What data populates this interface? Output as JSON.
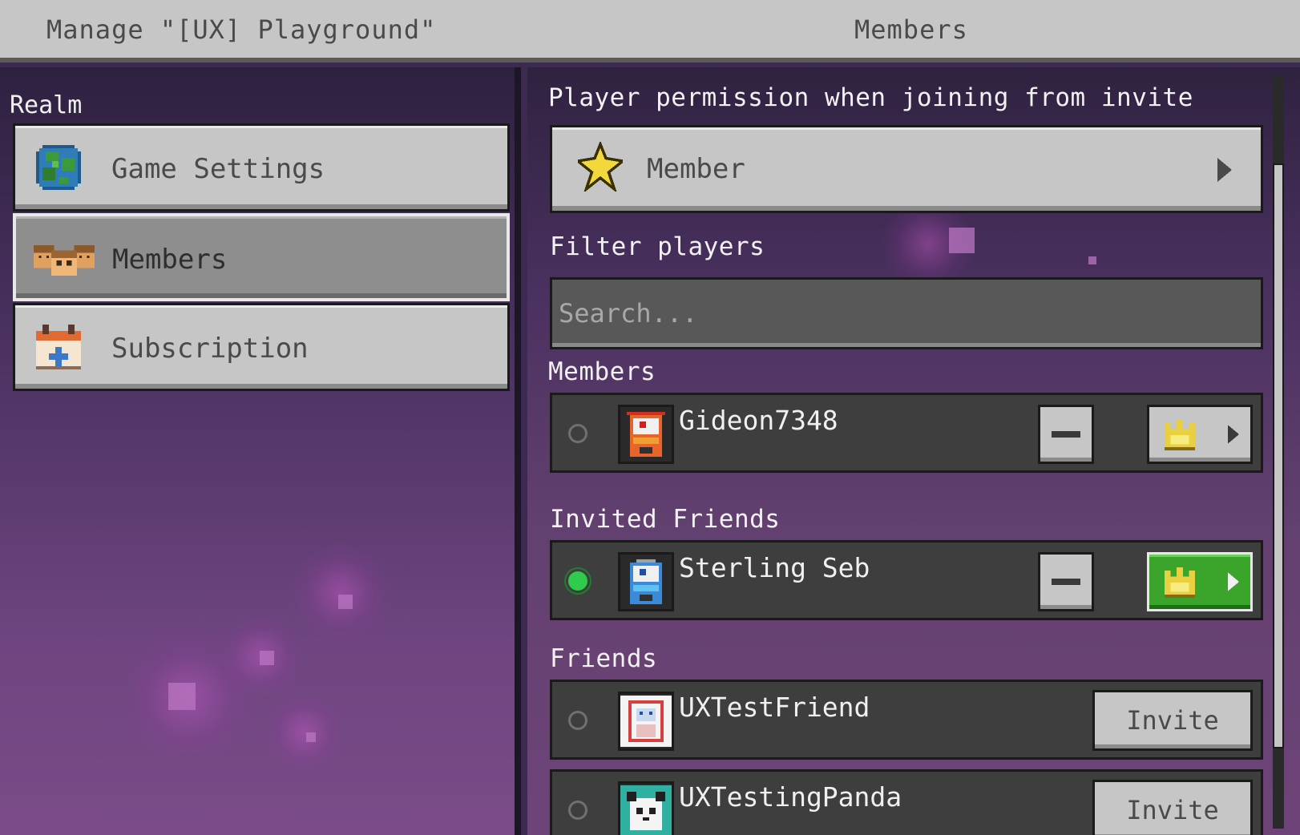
{
  "header": {
    "title": "Manage \"[UX] Playground\"",
    "section_title": "Members"
  },
  "sidebar": {
    "section_label": "Realm",
    "items": [
      {
        "label": "Game Settings",
        "icon": "globe-icon"
      },
      {
        "label": "Members",
        "icon": "members-icon",
        "selected": true
      },
      {
        "label": "Subscription",
        "icon": "calendar-plus-icon"
      }
    ]
  },
  "main": {
    "permission_label": "Player permission when joining from invite",
    "permission_value": "Member",
    "filter_label": "Filter players",
    "search_placeholder": "Search...",
    "members_label": "Members",
    "members": [
      {
        "name": "Gideon7348",
        "online": false
      }
    ],
    "invited_label": "Invited Friends",
    "invited": [
      {
        "name": "Sterling Seb",
        "online": true
      }
    ],
    "friends_label": "Friends",
    "friends": [
      {
        "name": "UXTestFriend",
        "online": false,
        "action": "Invite"
      },
      {
        "name": "UXTestingPanda",
        "online": false,
        "action": "Invite"
      }
    ]
  },
  "colors": {
    "button_gray": "#c6c6c6",
    "green_active": "#3aa52a",
    "online_green": "#2ecc4a",
    "background_purple": "#4b3160"
  }
}
